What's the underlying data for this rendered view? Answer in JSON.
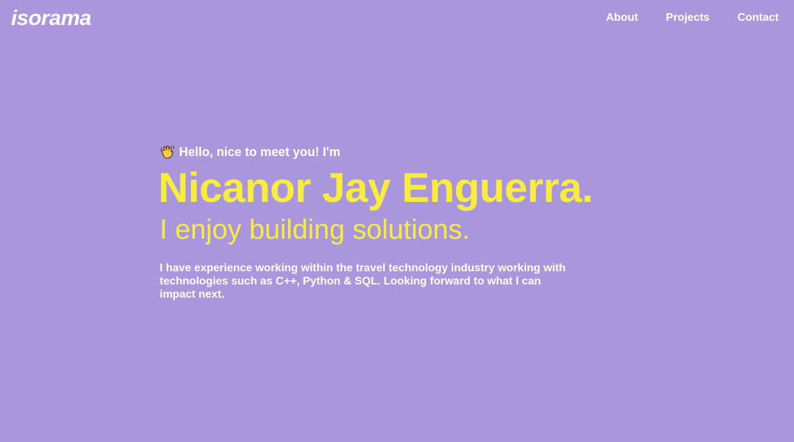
{
  "header": {
    "logo": "isorama",
    "nav": [
      {
        "label": "About"
      },
      {
        "label": "Projects"
      },
      {
        "label": "Contact"
      }
    ]
  },
  "hero": {
    "greeting_icon": "waving-hand-icon",
    "greeting": "Hello, nice to meet you! I'm",
    "name": "Nicanor Jay Enguerra.",
    "tagline": "I enjoy building solutions.",
    "bio": "I have experience working within the travel technology industry working with technologies such as C++, Python & SQL. Looking forward to what I can impact next."
  },
  "colors": {
    "background": "#a996dd",
    "accent": "#f8ed3f",
    "text": "#ffffff"
  }
}
